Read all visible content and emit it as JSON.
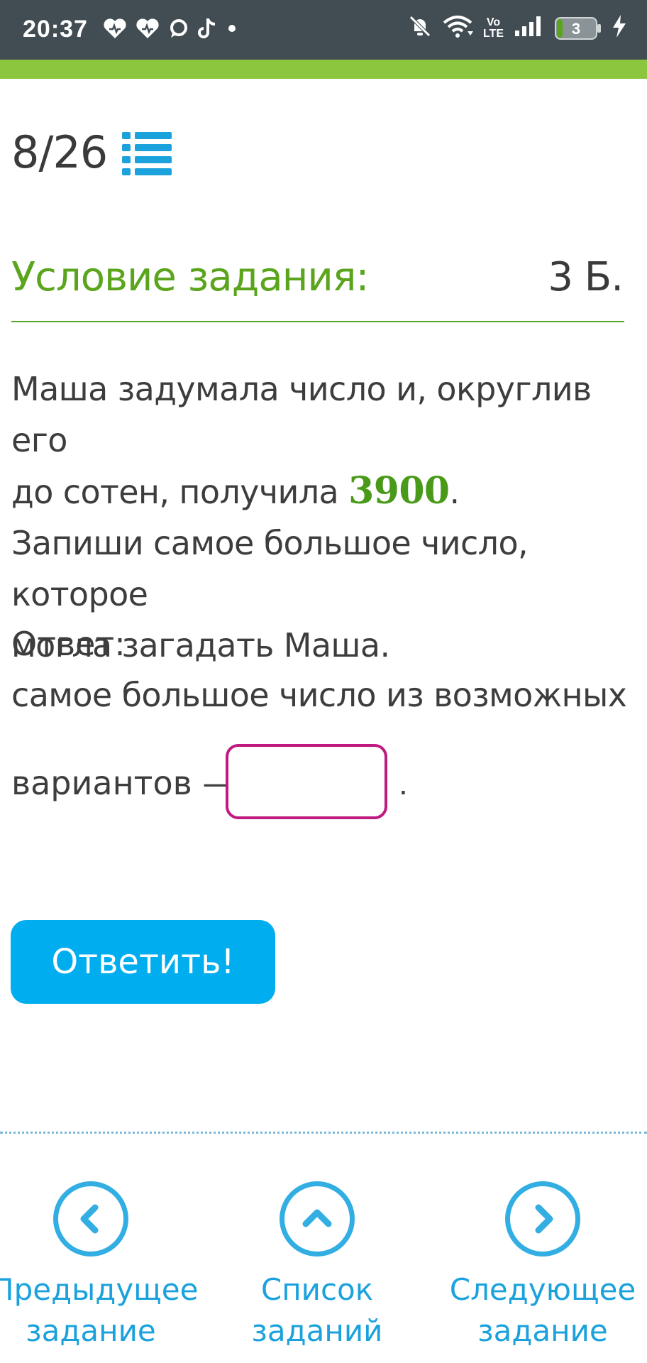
{
  "status_bar": {
    "time": "20:37",
    "battery_level": "3",
    "icons": [
      "heart-icon",
      "heart-icon",
      "chat-icon",
      "tiktok-icon",
      "dot-icon",
      "mute-icon",
      "wifi-icon",
      "volte-icon",
      "signal-icon",
      "battery-icon",
      "charging-icon"
    ],
    "volte_top": "Vo",
    "volte_bottom": "LTE"
  },
  "header": {
    "counter": "8/26"
  },
  "condition": {
    "title": "Условие задания:",
    "points": "3 Б."
  },
  "task": {
    "line1": "Маша задумала число и, округлив его",
    "line2_prefix": "до сотен, получила ",
    "number": "3900",
    "line2_suffix": ".",
    "line3": "Запиши самое большое число, которое",
    "line4": "могла загадать Маша."
  },
  "answer": {
    "label": "Ответ:",
    "line1": "самое большое число из возможных",
    "line2": "вариантов —",
    "input_value": "",
    "end_dot": "."
  },
  "submit_label": "Ответить!",
  "nav": {
    "prev": {
      "line1": "Предыдущее",
      "line2": "задание"
    },
    "list": {
      "line1": "Список",
      "line2": "заданий"
    },
    "next": {
      "line1": "Следующее",
      "line2": "задание"
    }
  },
  "colors": {
    "accent_green": "#5aa51c",
    "accent_blue": "#00aeef",
    "input_border": "#c0197f",
    "status_bar": "#414d52"
  }
}
